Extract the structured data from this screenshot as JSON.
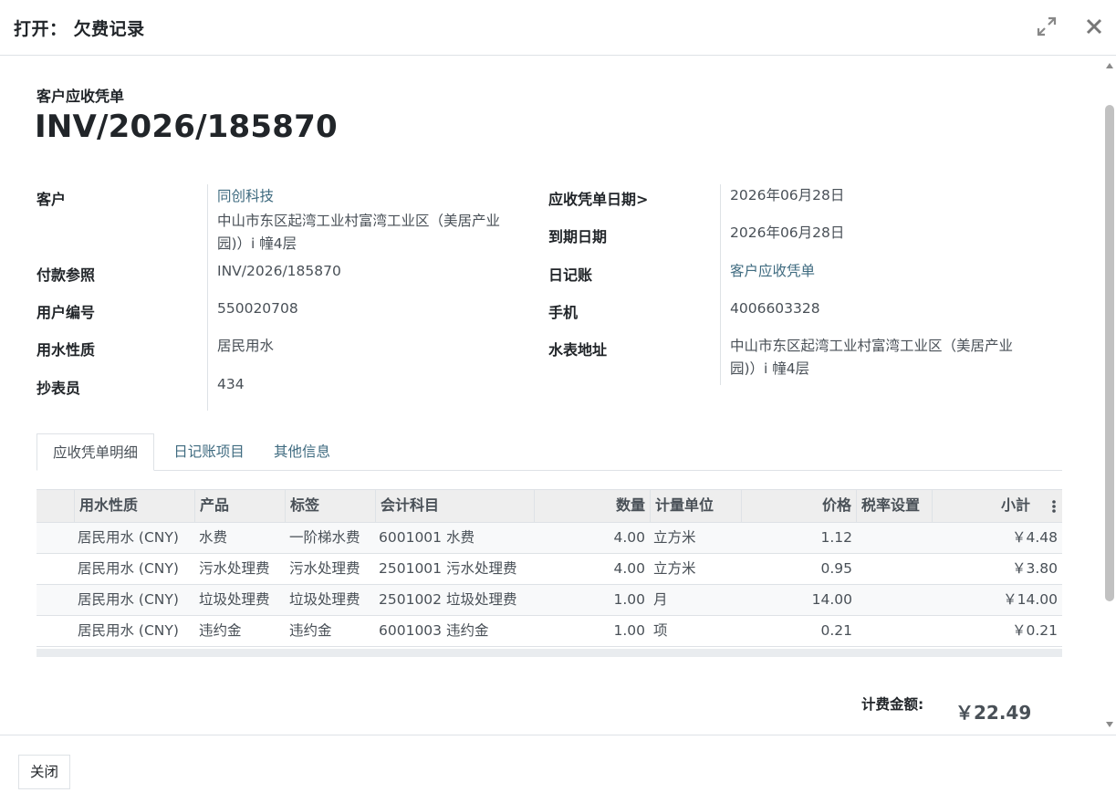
{
  "dialog": {
    "title": "打开： 欠费记录",
    "expand_icon": "expand-arrows-icon",
    "close_icon": "close-x-icon"
  },
  "record": {
    "type_label": "客户应收凭单",
    "number": "INV/2026/185870"
  },
  "fields_left": [
    {
      "label": "客户",
      "value": "同创科技",
      "is_link": true
    },
    {
      "label": "",
      "value": "中山市东区起湾工业村富湾工业区（美居产业园)）i 幢4层",
      "is_link": false
    },
    {
      "label": "付款参照",
      "value": "INV/2026/185870",
      "is_link": false
    },
    {
      "label": "用户编号",
      "value": "550020708",
      "is_link": false
    },
    {
      "label": "用水性质",
      "value": "居民用水",
      "is_link": false
    },
    {
      "label": "抄表员",
      "value": "434",
      "is_link": false
    }
  ],
  "fields_right": [
    {
      "label": "应收凭单日期>",
      "value": "2026年06月28日",
      "is_link": false
    },
    {
      "label": "到期日期",
      "value": "2026年06月28日",
      "is_link": false
    },
    {
      "label": "日记账",
      "value": "客户应收凭单",
      "is_link": true
    },
    {
      "label": "手机",
      "value": "4006603328",
      "is_link": false
    },
    {
      "label": "水表地址",
      "value": "中山市东区起湾工业村富湾工业区（美居产业园)）i 幢4层",
      "is_link": false
    }
  ],
  "tabs": [
    {
      "label": "应收凭单明细",
      "active": true
    },
    {
      "label": "日记账项目",
      "active": false
    },
    {
      "label": "其他信息",
      "active": false
    }
  ],
  "table": {
    "columns": [
      "用水性质",
      "产品",
      "标签",
      "会计科目",
      "数量",
      "计量单位",
      "价格",
      "税率设置",
      "小計"
    ],
    "options_icon": "vertical-dots-icon",
    "rows": [
      [
        "居民用水 (CNY)",
        "水费",
        "一阶梯水费",
        "6001001 水费",
        "4.00",
        "立方米",
        "1.12",
        "",
        "￥4.48"
      ],
      [
        "居民用水 (CNY)",
        "污水处理费",
        "污水处理费",
        "2501001 污水处理费",
        "4.00",
        "立方米",
        "0.95",
        "",
        "￥3.80"
      ],
      [
        "居民用水 (CNY)",
        "垃圾处理费",
        "垃圾处理费",
        "2501002 垃圾处理费",
        "1.00",
        "月",
        "14.00",
        "",
        "￥14.00"
      ],
      [
        "居民用水 (CNY)",
        "违约金",
        "违约金",
        "6001003 违约金",
        "1.00",
        "项",
        "0.21",
        "",
        "￥0.21"
      ]
    ]
  },
  "total": {
    "label": "计费金额:",
    "value": "￥22.49"
  },
  "footer": {
    "close_label": "关闭"
  }
}
